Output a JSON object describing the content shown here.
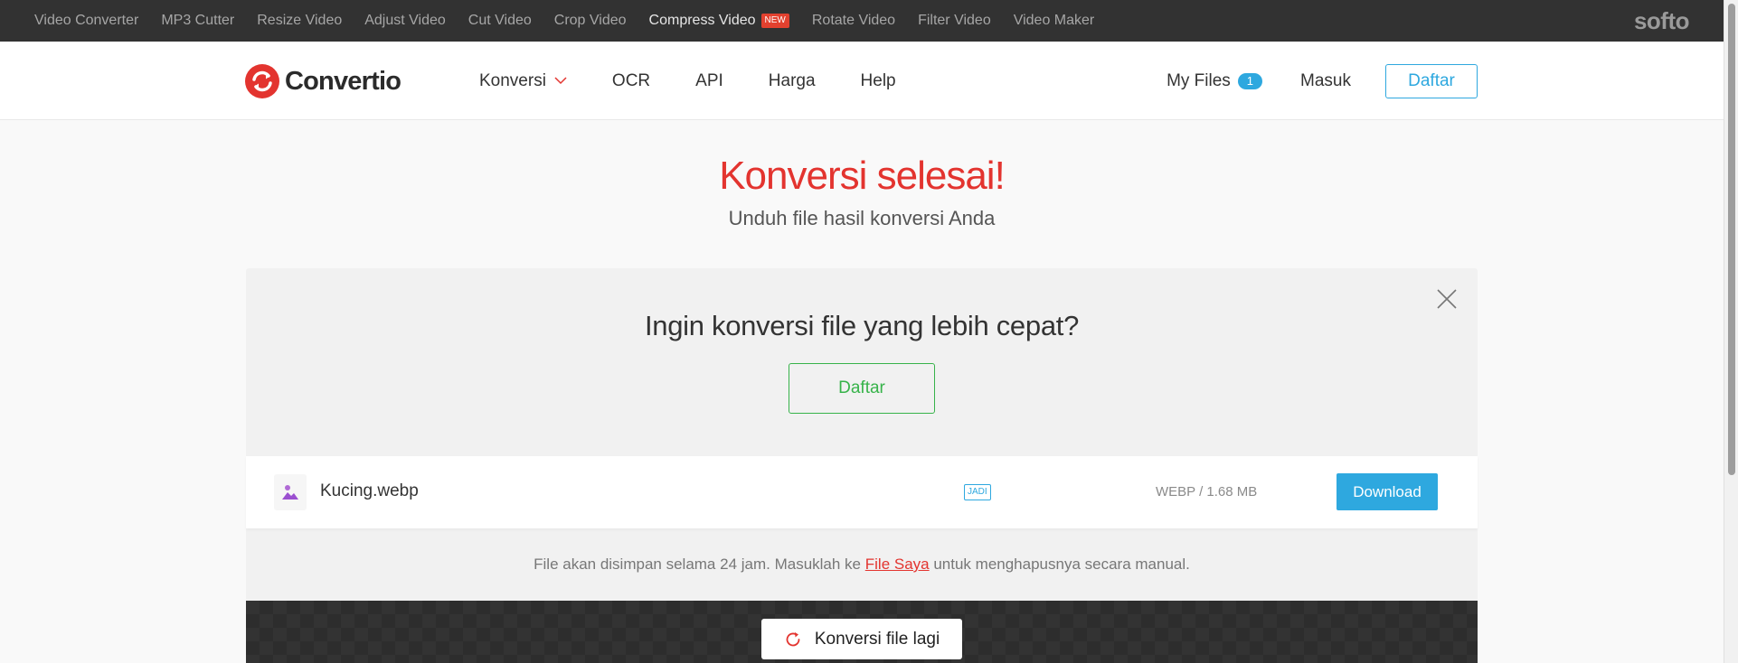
{
  "softo_bar": {
    "links": [
      {
        "label": "Video Converter"
      },
      {
        "label": "MP3 Cutter"
      },
      {
        "label": "Resize Video"
      },
      {
        "label": "Adjust Video"
      },
      {
        "label": "Cut Video"
      },
      {
        "label": "Crop Video"
      },
      {
        "label": "Compress Video",
        "badge": "NEW"
      },
      {
        "label": "Rotate Video"
      },
      {
        "label": "Filter Video"
      },
      {
        "label": "Video Maker"
      }
    ],
    "logo": "softo"
  },
  "header": {
    "logo_text": "Convertio",
    "nav": [
      {
        "label": "Konversi"
      },
      {
        "label": "OCR"
      },
      {
        "label": "API"
      },
      {
        "label": "Harga"
      },
      {
        "label": "Help"
      }
    ],
    "my_files_label": "My Files",
    "my_files_count": "1",
    "login_label": "Masuk",
    "register_label": "Daftar"
  },
  "main": {
    "title": "Konversi selesai!",
    "subtitle": "Unduh file hasil konversi Anda",
    "promo": {
      "title": "Ingin konversi file yang lebih cepat?",
      "button": "Daftar"
    },
    "file": {
      "name": "Kucing.webp",
      "status": "JADI",
      "meta": "WEBP / 1.68 MB",
      "download_label": "Download"
    },
    "notice": {
      "before": "File akan disimpan selama 24 jam. Masuklah ke ",
      "link": "File Saya",
      "after": " untuk menghapusnya secara manual."
    },
    "convert_again_label": "Konversi file lagi"
  },
  "colors": {
    "accent_red": "#e3342f",
    "accent_blue": "#2ea8df",
    "accent_green": "#37b34a",
    "topbar_bg": "#323232"
  }
}
